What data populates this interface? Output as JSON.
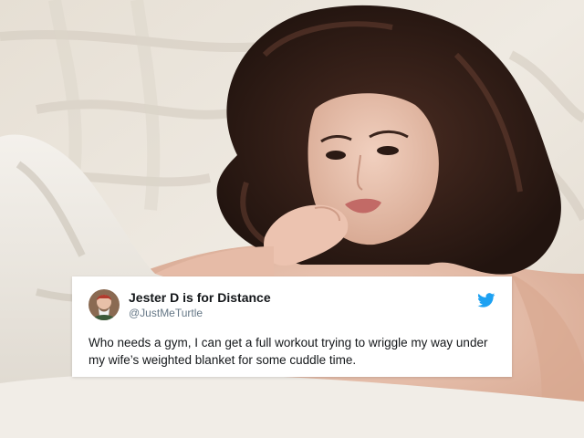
{
  "tweet": {
    "display_name": "Jester D is for Distance",
    "handle": "@JustMeTurtle",
    "text": "Who needs a gym, I can get a full workout trying to wriggle my way under my wife’s weighted blanket for some cuddle time.",
    "avatar_icon": "avatar-photo",
    "brand_icon": "twitter-bird-icon",
    "brand_color": "#1DA1F2"
  }
}
